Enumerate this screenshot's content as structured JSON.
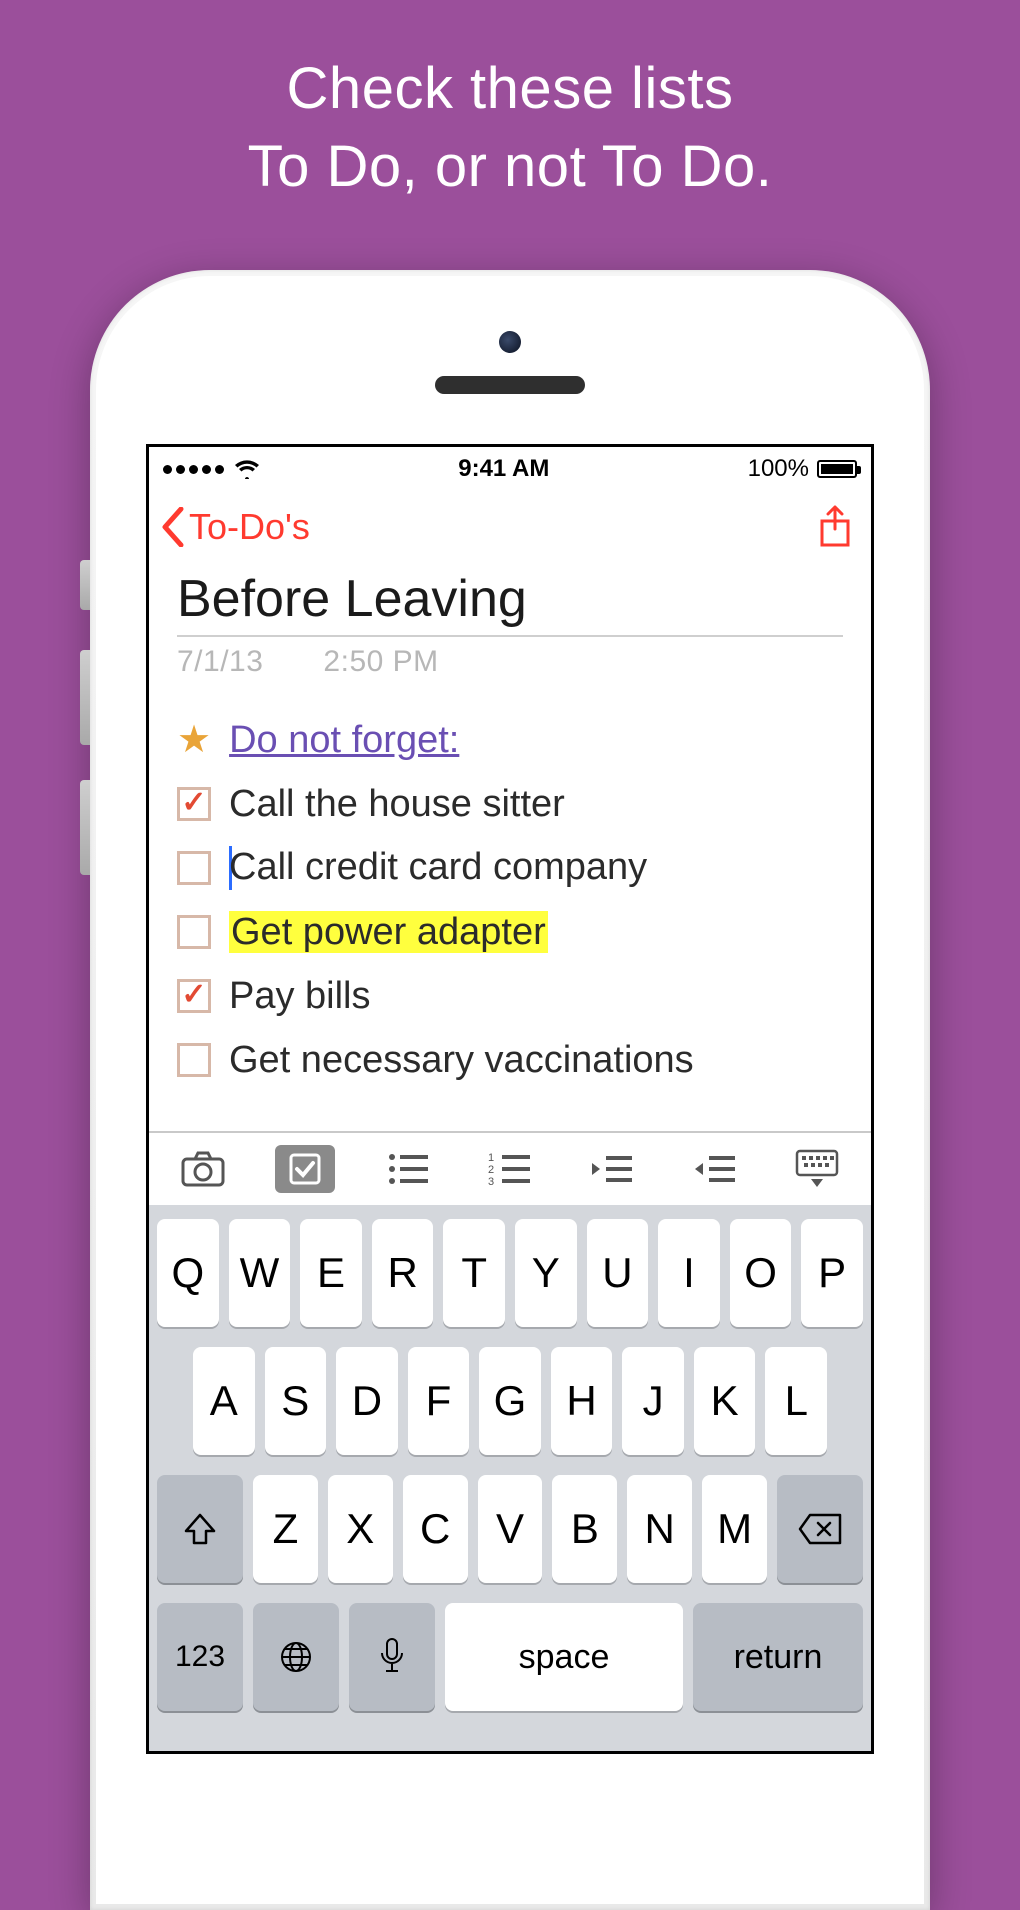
{
  "promo": {
    "line1": "Check these lists",
    "line2": "To Do, or not To Do."
  },
  "status": {
    "time": "9:41 AM",
    "battery_text": "100%"
  },
  "nav": {
    "back_label": "To-Do's"
  },
  "note": {
    "title": "Before Leaving",
    "date": "7/1/13",
    "time": "2:50 PM",
    "heading": "Do not forget:",
    "items": [
      {
        "text": "Call the house sitter",
        "checked": true,
        "highlight": false,
        "cursor": false
      },
      {
        "text": "Call credit card company",
        "checked": false,
        "highlight": false,
        "cursor": true
      },
      {
        "text": "Get power adapter",
        "checked": false,
        "highlight": true,
        "cursor": false
      },
      {
        "text": "Pay bills",
        "checked": true,
        "highlight": false,
        "cursor": false
      },
      {
        "text": "Get necessary vaccinations",
        "checked": false,
        "highlight": false,
        "cursor": false
      }
    ]
  },
  "keyboard": {
    "row1": [
      "Q",
      "W",
      "E",
      "R",
      "T",
      "Y",
      "U",
      "I",
      "O",
      "P"
    ],
    "row2": [
      "A",
      "S",
      "D",
      "F",
      "G",
      "H",
      "J",
      "K",
      "L"
    ],
    "row3": [
      "Z",
      "X",
      "C",
      "V",
      "B",
      "N",
      "M"
    ],
    "numbers_label": "123",
    "space_label": "space",
    "return_label": "return"
  },
  "colors": {
    "background": "#9b4f9b",
    "accent": "#ff3a2f",
    "heading": "#6a4fb3",
    "highlight": "#ffff3e",
    "star": "#e9a438"
  }
}
